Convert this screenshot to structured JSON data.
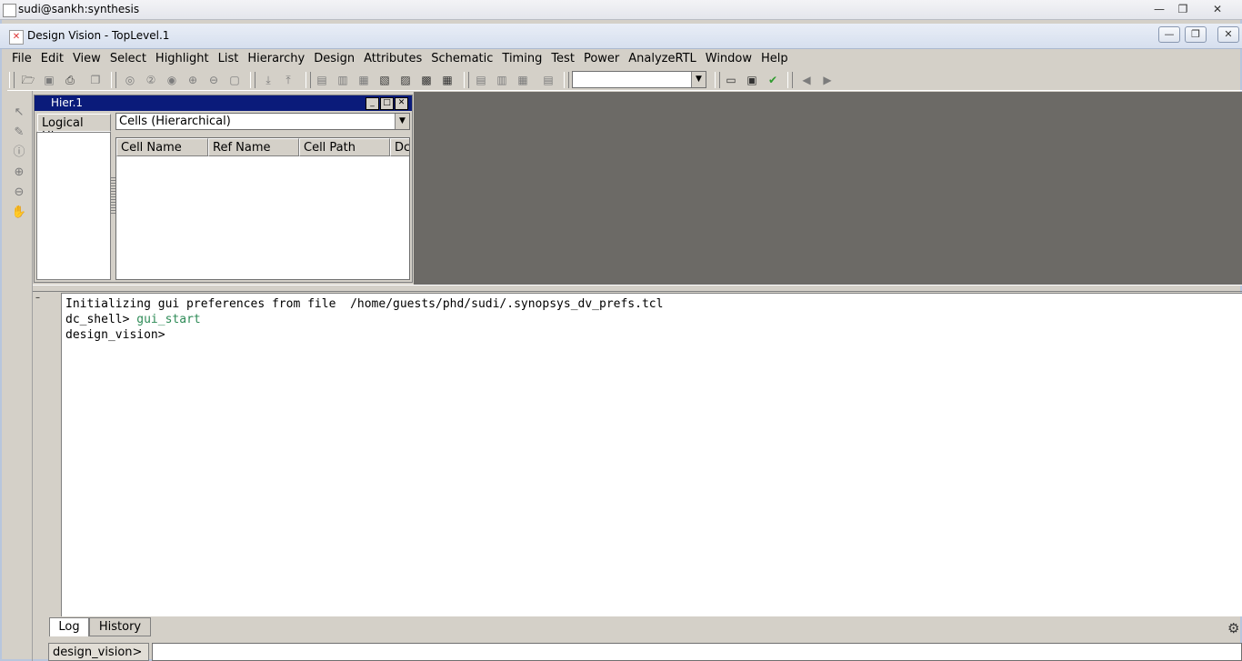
{
  "outer_window": {
    "title": "sudi@sankh:synthesis",
    "buttons": [
      "—",
      "❐",
      "✕"
    ]
  },
  "app_window": {
    "title": "Design Vision - TopLevel.1",
    "buttons": [
      "—",
      "❐",
      "✕"
    ]
  },
  "menu": [
    {
      "label": "File"
    },
    {
      "label": "Edit"
    },
    {
      "label": "View"
    },
    {
      "label": "Select"
    },
    {
      "label": "Highlight"
    },
    {
      "label": "List"
    },
    {
      "label": "Hierarchy"
    },
    {
      "label": "Design"
    },
    {
      "label": "Attributes"
    },
    {
      "label": "Schematic"
    },
    {
      "label": "Timing"
    },
    {
      "label": "Test"
    },
    {
      "label": "Power"
    },
    {
      "label": "AnalyzeRTL"
    },
    {
      "label": "Window"
    },
    {
      "label": "Help"
    }
  ],
  "toolbar": {
    "combo_value": ""
  },
  "hier_window": {
    "title": "Hier.1",
    "logical_tab": "Logical Hier",
    "cells_filter": "Cells (Hierarchical)",
    "columns": [
      "Cell Name",
      "Ref Name",
      "Cell Path",
      "Dc"
    ]
  },
  "console": {
    "lines": [
      {
        "text": "Initializing gui preferences from file  /home/guests/phd/sudi/.synopsys_dv_prefs.tcl"
      },
      {
        "prompt": "dc_shell> ",
        "cmd": "gui_start"
      },
      {
        "text": "design_vision> "
      }
    ]
  },
  "bottom": {
    "tabs": [
      "Log",
      "History"
    ],
    "prompt": "design_vision>",
    "input_value": ""
  }
}
